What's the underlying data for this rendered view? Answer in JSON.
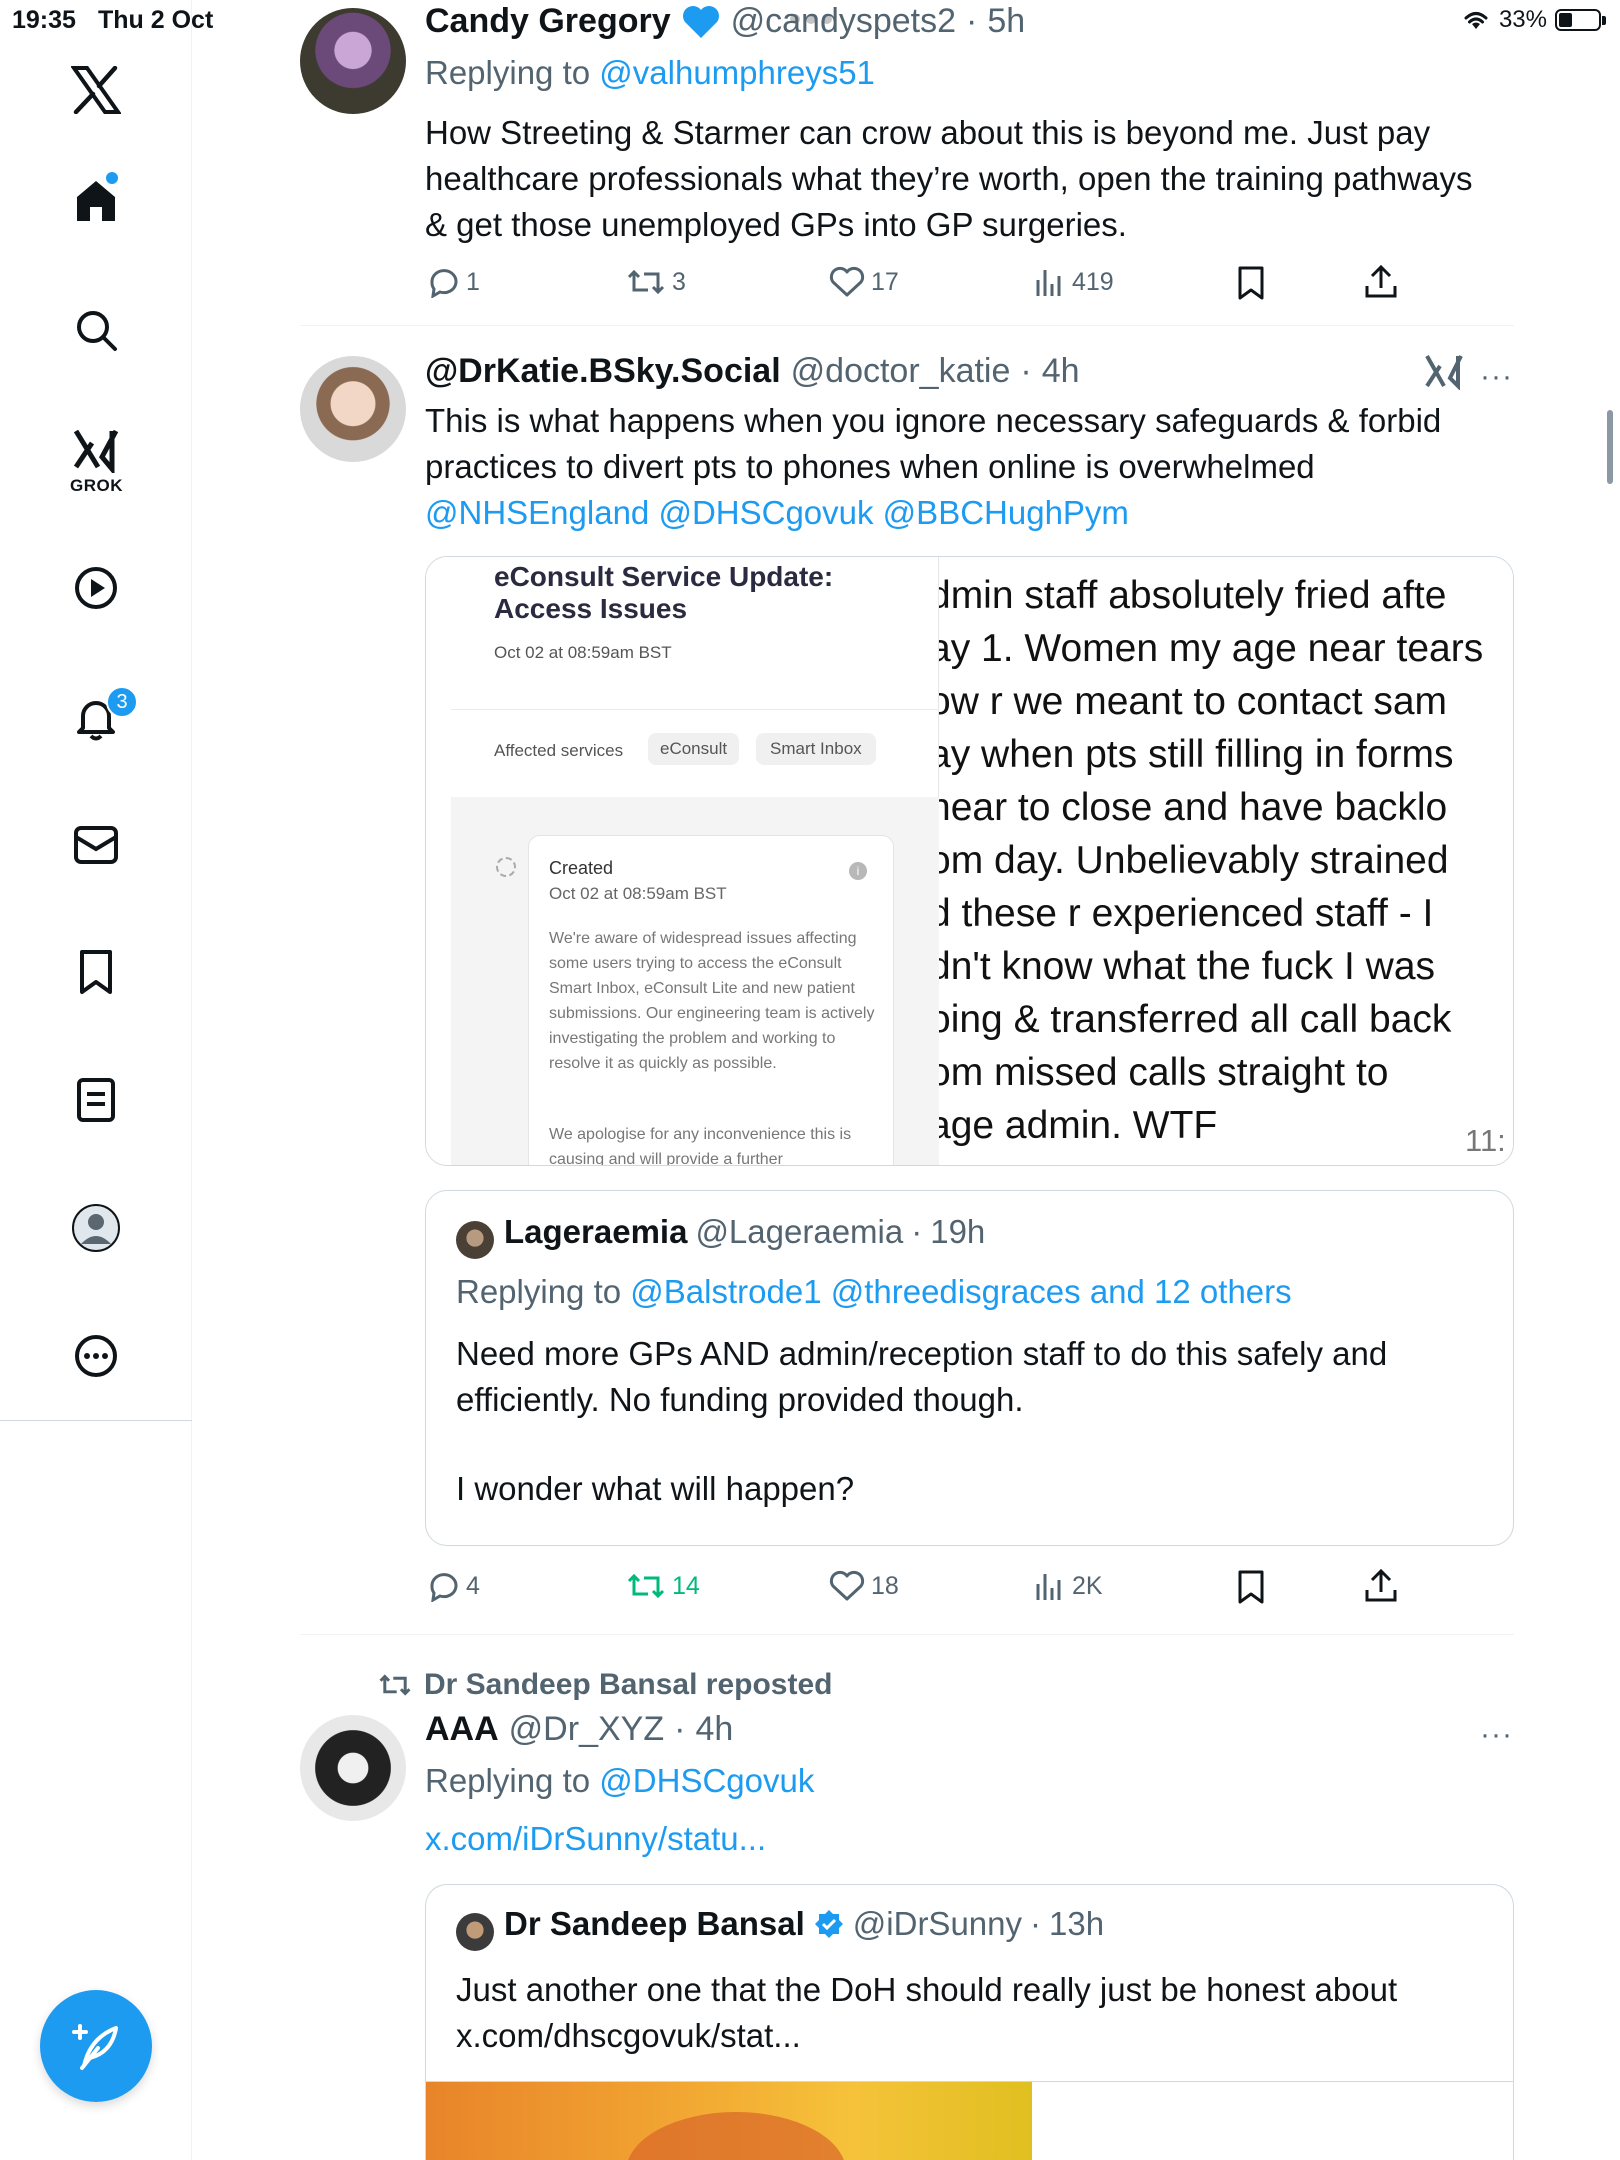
{
  "status_bar": {
    "time": "19:35",
    "date": "Thu 2 Oct",
    "battery": "33%"
  },
  "sidebar": {
    "grok_label": "GROK",
    "notifications_badge": "3",
    "icons": [
      "x-logo-icon",
      "home-icon",
      "search-icon",
      "grok-icon",
      "video-icon",
      "bell-icon",
      "mail-icon",
      "bookmark-icon",
      "lists-icon",
      "profile-icon",
      "more-icon"
    ]
  },
  "tweet1": {
    "name": "Candy Gregory",
    "handle": "@candyspets2",
    "time": "5h",
    "replying_prefix": "Replying to",
    "replying_to": "@valhumphreys51",
    "text": "How Streeting & Starmer can crow about this is beyond me. Just pay healthcare professionals what they’re worth, open the training pathways & get those unemployed GPs into GP surgeries.",
    "replies": "1",
    "reposts": "3",
    "likes": "17",
    "views": "419"
  },
  "tweet2": {
    "name": "@DrKatie.BSky.Social",
    "handle": "@doctor_katie",
    "time": "4h",
    "text": "This is what happens when you ignore necessary safeguards & forbid practices to divert pts to phones when online is overwhelmed",
    "mentions": "@NHSEngland @DHSCgovuk @BBCHughPym",
    "media_left": {
      "title_line1": "eConsult Service Update:",
      "title_line2": "Access Issues",
      "date": "Oct 02 at 08:59am BST",
      "affected_label": "Affected services",
      "chip1": "eConsult",
      "chip2": "Smart Inbox",
      "created_label": "Created",
      "created_date": "Oct 02 at 08:59am BST",
      "para1": "We're aware of widespread issues affecting some users trying to access the eConsult Smart Inbox, eConsult Lite and new patient submissions. Our engineering team is actively investigating the problem and working to resolve it as quickly as possible.",
      "para2": "We apologise for any inconvenience this is causing and will provide a further"
    },
    "media_right": {
      "lines": [
        "dmin staff absolutely fried afte",
        "ay 1. Women my age near tears",
        "ow r we meant to contact sam",
        "ay when pts still filling in forms",
        "near to close and have backlo",
        "om day. Unbelievably strained",
        "d these r experienced staff - I",
        "dn't know what the fuck I was",
        "oing & transferred all call back",
        "om missed calls straight to",
        "age admin. WTF"
      ],
      "timestamp": "11:"
    },
    "quote": {
      "name": "Lageraemia",
      "handle": "@Lageraemia",
      "time": "19h",
      "replying_prefix": "Replying to",
      "replying_to": "@Balstrode1 @threedisgraces and 12 others",
      "text1": "Need more GPs AND admin/reception staff to do this safely and efficiently. No funding provided though.",
      "text2": "I wonder what will happen?"
    },
    "replies": "4",
    "reposts": "14",
    "likes": "18",
    "views": "2K"
  },
  "tweet3": {
    "reposted_by": "Dr Sandeep Bansal reposted",
    "name": "AAA",
    "handle": "@Dr_XYZ",
    "time": "4h",
    "replying_prefix": "Replying to",
    "replying_to": "@DHSCgovuk",
    "link": "x.com/iDrSunny/statu...",
    "quote": {
      "name": "Dr Sandeep Bansal",
      "handle": "@iDrSunny",
      "time": "13h",
      "text": "Just another one that the DoH should really just be honest about",
      "link": "x.com/dhscgovuk/stat..."
    }
  },
  "colors": {
    "accent": "#1d9bf0",
    "repost_active": "#00ba7c",
    "text": "#0f1419",
    "muted": "#536471"
  }
}
